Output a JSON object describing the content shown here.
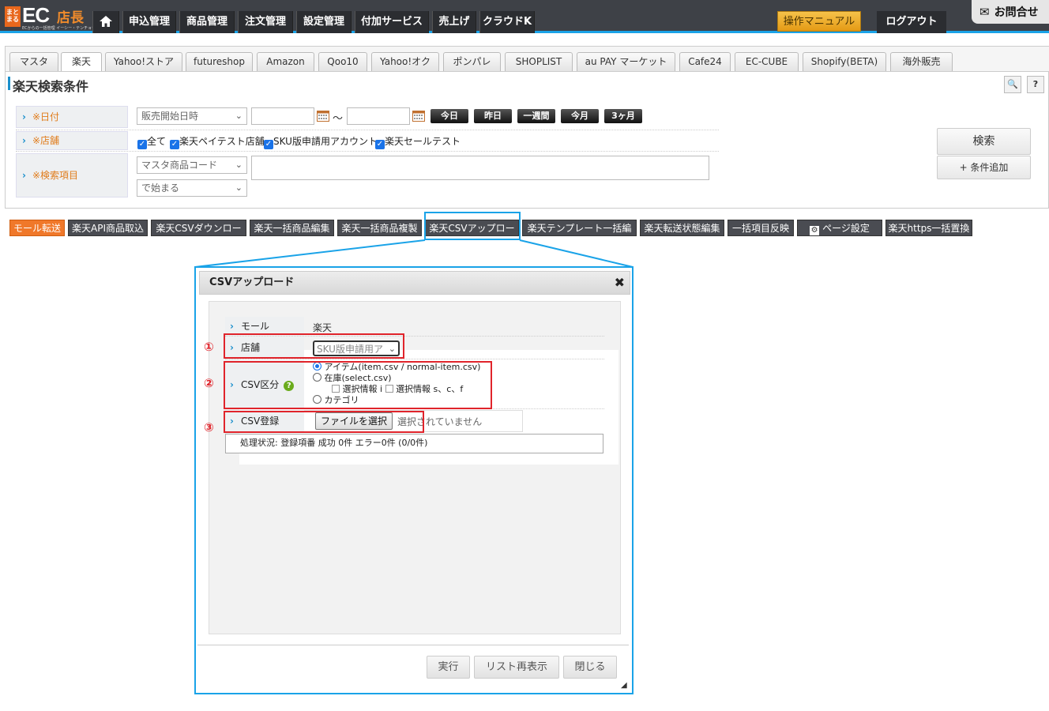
{
  "logo": {
    "mark": "まとまる",
    "ec": "EC",
    "ten": "店長",
    "tagline": "ECからの一括管理 イーシー・テンチョウ"
  },
  "nav": {
    "items": [
      "申込管理",
      "商品管理",
      "注文管理",
      "設定管理",
      "付加サービス",
      "売上げ",
      "クラウドK"
    ],
    "manual": "操作マニュアル",
    "logout": "ログアウト",
    "contact": "お問合せ"
  },
  "mall_tabs": [
    "マスタ",
    "楽天",
    "Yahoo!ストア",
    "futureshop",
    "Amazon",
    "Qoo10",
    "Yahoo!オク",
    "ポンパレ",
    "SHOPLIST",
    "au PAY マーケット",
    "Cafe24",
    "EC-CUBE",
    "Shopify(BETA)",
    "海外販売"
  ],
  "active_tab": "楽天",
  "search": {
    "title": "楽天検索条件",
    "search_icon": "🔍",
    "help_icon": "?",
    "date_label": "※日付",
    "date_select": "販売開始日時",
    "range_sep": "〜",
    "quick": [
      "今日",
      "昨日",
      "一週間",
      "今月",
      "3ヶ月"
    ],
    "store_label": "※店舗",
    "stores": [
      "全て",
      "楽天ペイテスト店舗",
      "SKU版申請用アカウント",
      "楽天セールテスト"
    ],
    "item_label": "※検索項目",
    "item_select": "マスタ商品コード",
    "match_select": "で始まる",
    "search_button": "検索",
    "add_condition": "+ 条件追加"
  },
  "toolbar": [
    "モール転送",
    "楽天API商品取込",
    "楽天CSVダウンロード",
    "楽天一括商品編集",
    "楽天一括商品複製",
    "楽天CSVアップロード",
    "楽天テンプレート一括編集",
    "楽天転送状態編集",
    "一括項目反映",
    "ページ設定",
    "楽天https一括置換"
  ],
  "dialog": {
    "title": "CSVアップロード",
    "close": "✖",
    "mall_label": "モール",
    "mall_value": "楽天",
    "store_label": "店舗",
    "store_value": "SKU版申請用ア",
    "csv_type_label": "CSV区分",
    "opt_item": "アイテム(item.csv / normal-item.csv)",
    "opt_stock": "在庫(select.csv)",
    "sub_i": "選択情報 i",
    "sub_scf": "選択情報 s、c、f",
    "opt_category": "カテゴリ",
    "csv_reg_label": "CSV登録",
    "file_button": "ファイルを選択",
    "file_status": "選択されていません",
    "process_status": "処理状況: 登録項番 成功 0件 エラー0件 (0/0件)",
    "run": "実行",
    "reload": "リスト再表示",
    "close_button": "閉じる"
  },
  "markers": [
    "①",
    "②",
    "③"
  ]
}
